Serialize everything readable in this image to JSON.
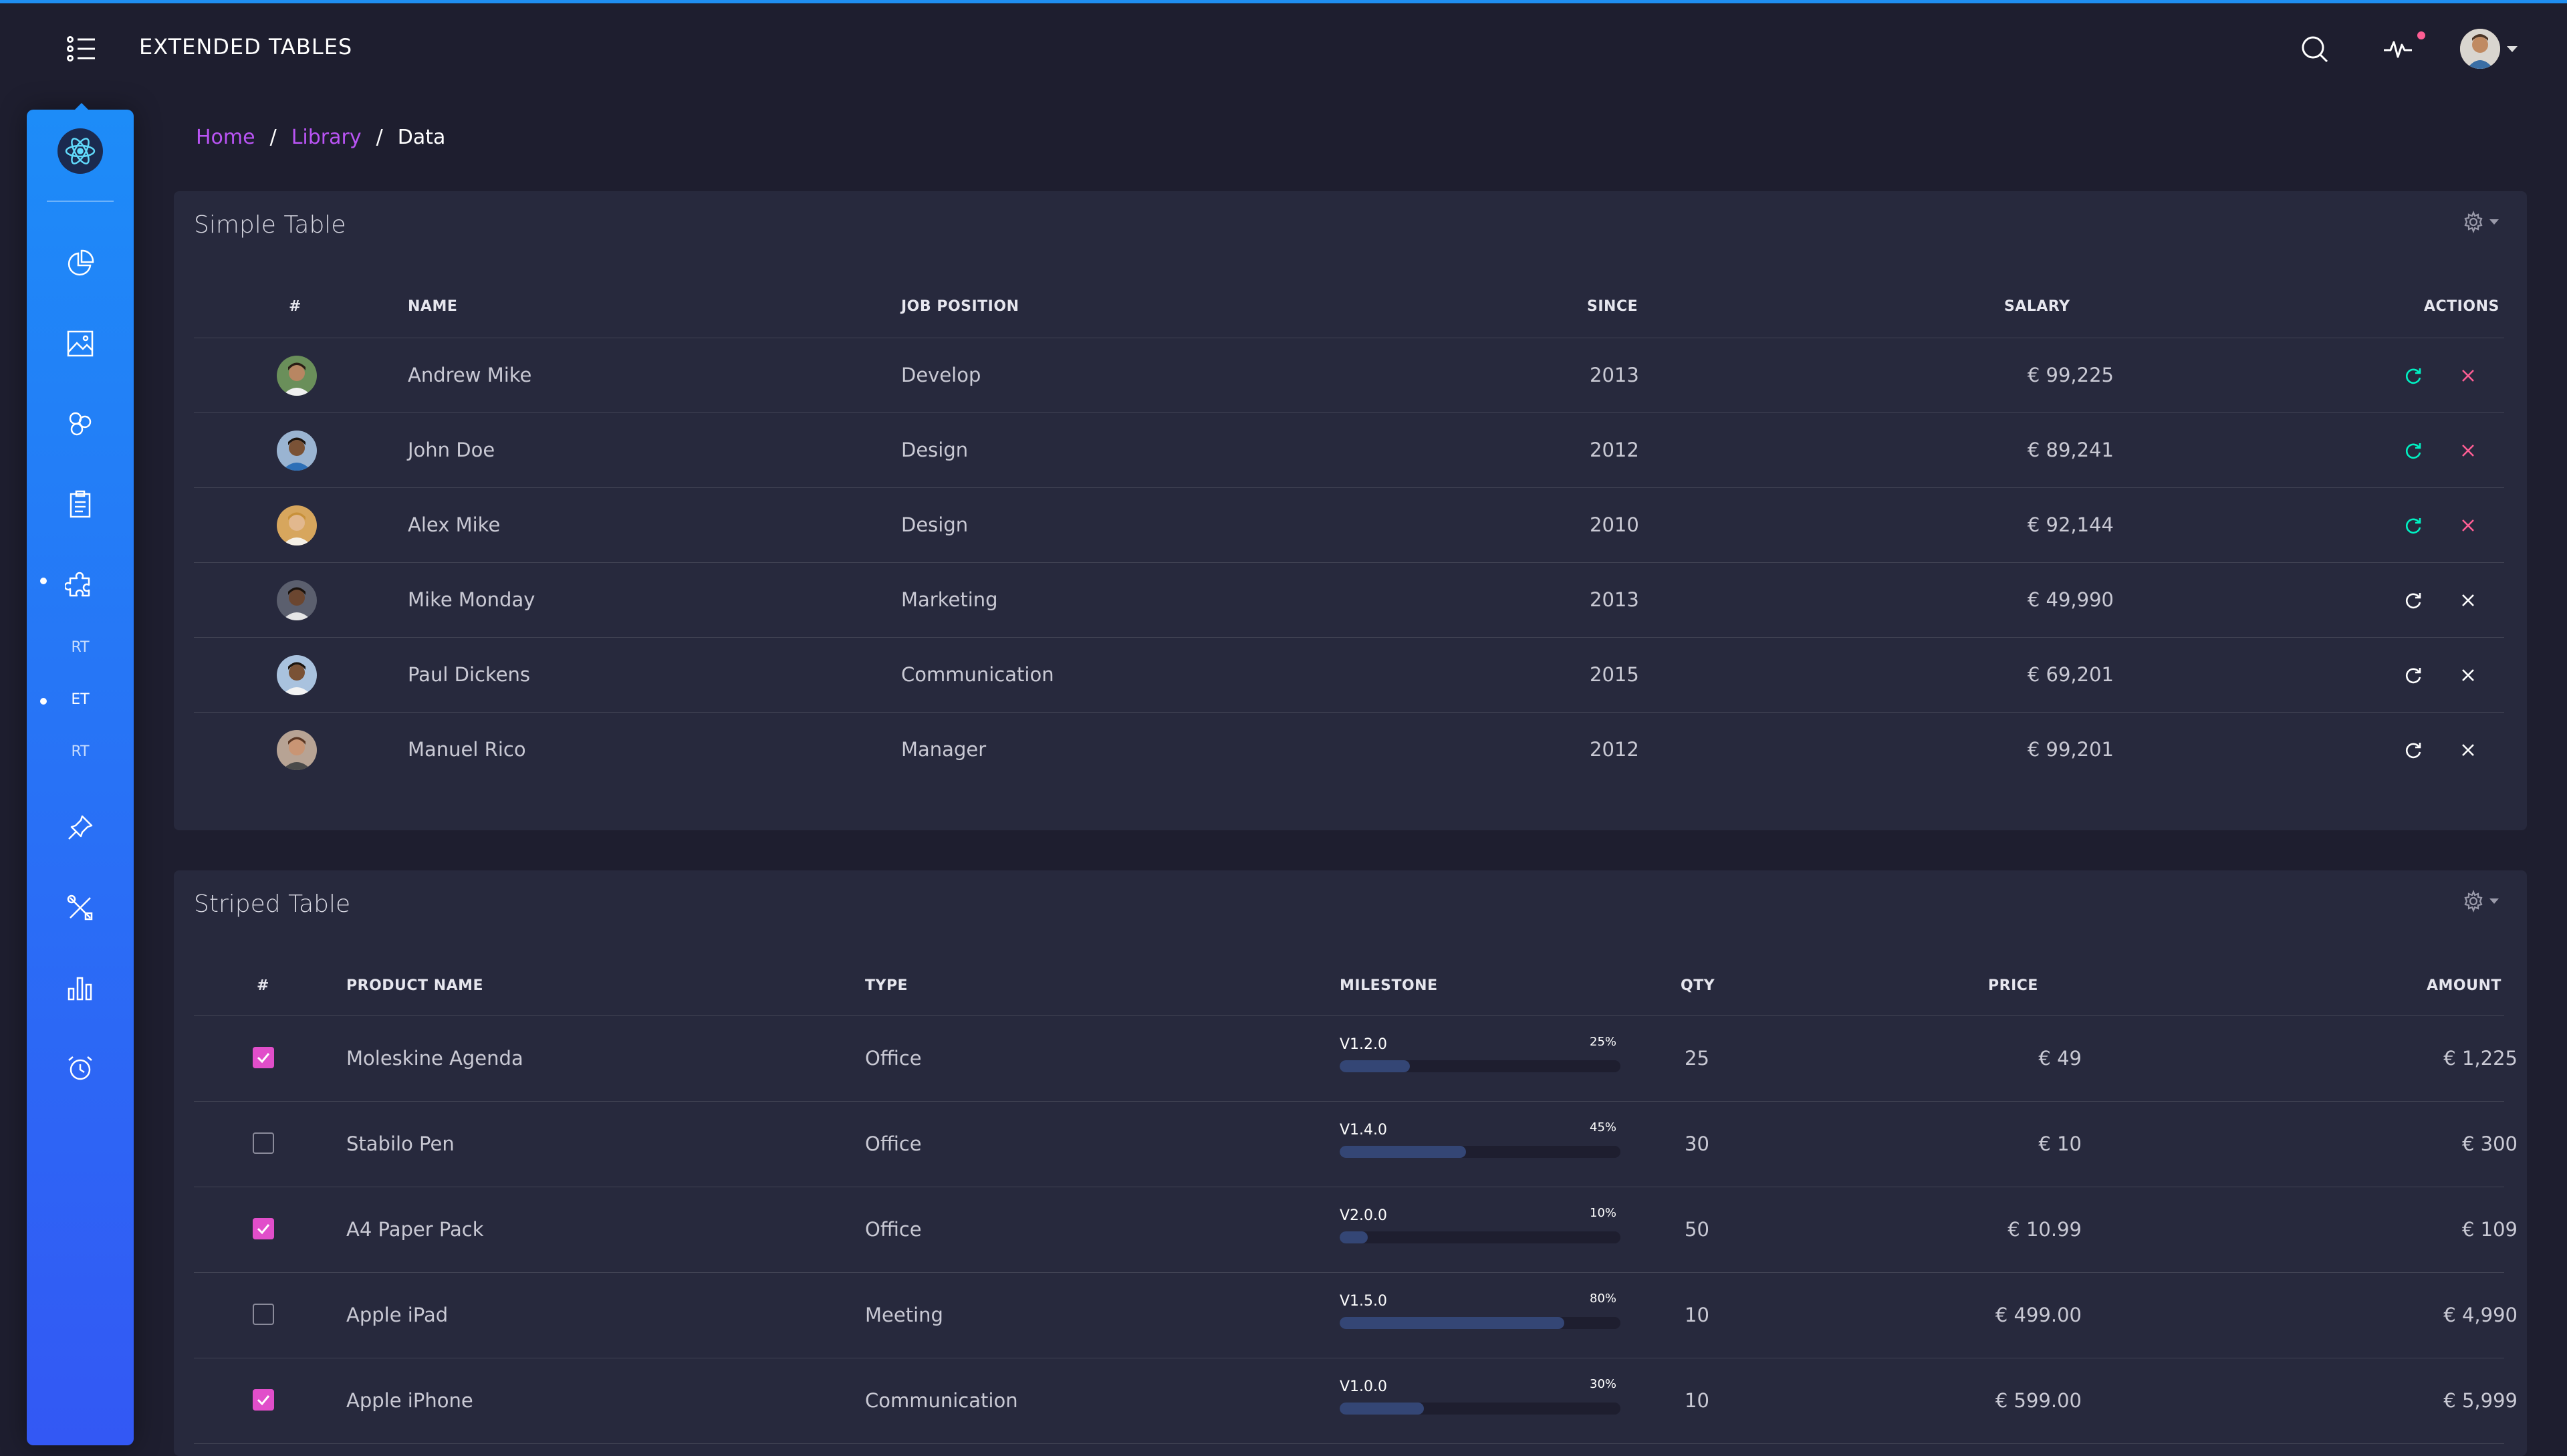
{
  "navbar": {
    "title": "EXTENDED TABLES",
    "icons": [
      "menu-list-icon",
      "search-icon",
      "activity-icon",
      "user-avatar"
    ]
  },
  "sidebar": {
    "items": [
      {
        "icon": "chart-pie-icon"
      },
      {
        "icon": "image-icon"
      },
      {
        "icon": "molecule-icon"
      },
      {
        "icon": "clipboard-icon"
      },
      {
        "icon": "puzzle-icon"
      },
      {
        "label": "RT"
      },
      {
        "label": "ET"
      },
      {
        "label": "RT"
      },
      {
        "icon": "pin-icon"
      },
      {
        "icon": "tools-icon"
      },
      {
        "icon": "bar-chart-icon"
      },
      {
        "icon": "alarm-clock-icon"
      }
    ]
  },
  "breadcrumb": {
    "home": "Home",
    "library": "Library",
    "current": "Data",
    "sep": "/"
  },
  "simple_table": {
    "title": "Simple Table",
    "headers": [
      "#",
      "NAME",
      "JOB POSITION",
      "SINCE",
      "SALARY",
      "ACTIONS"
    ],
    "rows": [
      {
        "name": "Andrew Mike",
        "job": "Develop",
        "since": "2013",
        "salary": "€ 99,225",
        "actions_color": "colored"
      },
      {
        "name": "John Doe",
        "job": "Design",
        "since": "2012",
        "salary": "€ 89,241",
        "actions_color": "colored"
      },
      {
        "name": "Alex Mike",
        "job": "Design",
        "since": "2010",
        "salary": "€ 92,144",
        "actions_color": "colored"
      },
      {
        "name": "Mike Monday",
        "job": "Marketing",
        "since": "2013",
        "salary": "€ 49,990",
        "actions_color": "white"
      },
      {
        "name": "Paul Dickens",
        "job": "Communication",
        "since": "2015",
        "salary": "€ 69,201",
        "actions_color": "white"
      },
      {
        "name": "Manuel Rico",
        "job": "Manager",
        "since": "2012",
        "salary": "€ 99,201",
        "actions_color": "white"
      }
    ]
  },
  "striped_table": {
    "title": "Striped Table",
    "headers": [
      "#",
      "PRODUCT NAME",
      "TYPE",
      "MILESTONE",
      "QTY",
      "PRICE",
      "AMOUNT"
    ],
    "rows": [
      {
        "checked": true,
        "product": "Moleskine Agenda",
        "type": "Office",
        "milestone": "V1.2.0",
        "percent_label": "25%",
        "progress": 0.25,
        "qty": "25",
        "price": "€ 49",
        "amount": "€ 1,225"
      },
      {
        "checked": false,
        "product": "Stabilo Pen",
        "type": "Office",
        "milestone": "V1.4.0",
        "percent_label": "45%",
        "progress": 0.45,
        "qty": "30",
        "price": "€ 10",
        "amount": "€ 300"
      },
      {
        "checked": true,
        "product": "A4 Paper Pack",
        "type": "Office",
        "milestone": "V2.0.0",
        "percent_label": "10%",
        "progress": 0.1,
        "qty": "50",
        "price": "€ 10.99",
        "amount": "€ 109"
      },
      {
        "checked": false,
        "product": "Apple iPad",
        "type": "Meeting",
        "milestone": "V1.5.0",
        "percent_label": "80%",
        "progress": 0.8,
        "qty": "10",
        "price": "€ 499.00",
        "amount": "€ 4,990"
      },
      {
        "checked": true,
        "product": "Apple iPhone",
        "type": "Communication",
        "milestone": "V1.0.0",
        "percent_label": "30%",
        "progress": 0.3,
        "qty": "10",
        "price": "€ 599.00",
        "amount": "€ 5,999"
      }
    ]
  },
  "colors": {
    "accent_purple": "#ba54f5",
    "checkbox_pink": "#e14eca",
    "refresh_green": "#00f2c3",
    "remove_pink": "#fd5d93",
    "card_bg": "#27293d",
    "page_bg": "#1e1e2f"
  }
}
